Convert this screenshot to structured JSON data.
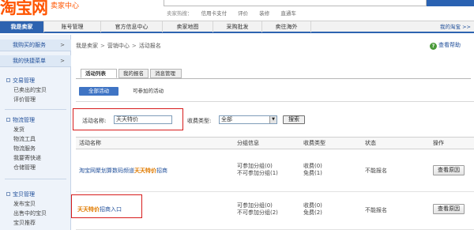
{
  "header": {
    "logo_text": "淘宝网",
    "logo_sub": "卖家中心",
    "hot_label": "卖家热搜：",
    "hot_links": [
      "信用卡支付",
      "评价",
      "装修",
      "直通车"
    ]
  },
  "topnav": {
    "tabs": [
      "我是卖家",
      "账号管理",
      "官方信息中心",
      "卖家地图",
      "采购批发",
      "卖往海外"
    ],
    "my_taobao": "我的淘宝 >>"
  },
  "sidebar": {
    "heads": [
      "我购买的服务",
      "我的快捷菜单"
    ],
    "head_arrow": ">",
    "groups": [
      {
        "title": "交易管理",
        "items": [
          "已卖出的宝贝",
          "评价管理"
        ]
      },
      {
        "title": "物流管理",
        "items": [
          "发货",
          "物流工具",
          "物流服务",
          "我要寄快递",
          "仓储管理"
        ]
      },
      {
        "title": "宝贝管理",
        "items": [
          "发布宝贝",
          "出售中的宝贝",
          "宝贝推荐"
        ]
      }
    ]
  },
  "breadcrumb": [
    "我是卖家",
    "营销中心",
    "活动报名"
  ],
  "help": {
    "label": "查看帮助"
  },
  "tabs": [
    "活动列表",
    "我的报名",
    "消息管理"
  ],
  "subtabs": {
    "active": "全部活动",
    "other": "可参加的活动"
  },
  "filter": {
    "name_label": "活动名称:",
    "name_value": "天天特价",
    "fee_label": "收费类型:",
    "fee_value": "全部",
    "search_button": "搜索"
  },
  "table": {
    "headers": [
      "活动名称",
      "分组信息",
      "收费类型",
      "状态",
      "操作"
    ],
    "rows": [
      {
        "name_prefix": "淘宝网聚划算数码频道",
        "name_highlight": "天天特价",
        "name_suffix": "招商",
        "group_lines": [
          "可参加分组(0)",
          "不可参加分组(1)"
        ],
        "fee_lines": [
          "收费(0)",
          "免费(1)"
        ],
        "status": "不能报名",
        "action": "查看原因"
      },
      {
        "name_prefix": "",
        "name_highlight": "天天特价",
        "name_suffix": "招商入口",
        "group_lines": [
          "可参加分组(0)",
          "不可参加分组(2)"
        ],
        "fee_lines": [
          "收费(0)",
          "免费(2)"
        ],
        "status": "不能报名",
        "action": "查看原因"
      }
    ]
  },
  "colors": {
    "brand": "#ff5500",
    "nav_blue": "#2d63b0",
    "highlight_box": "#d71c1c",
    "link_blue": "#1f4e99",
    "keyword_orange": "#e07b00"
  }
}
